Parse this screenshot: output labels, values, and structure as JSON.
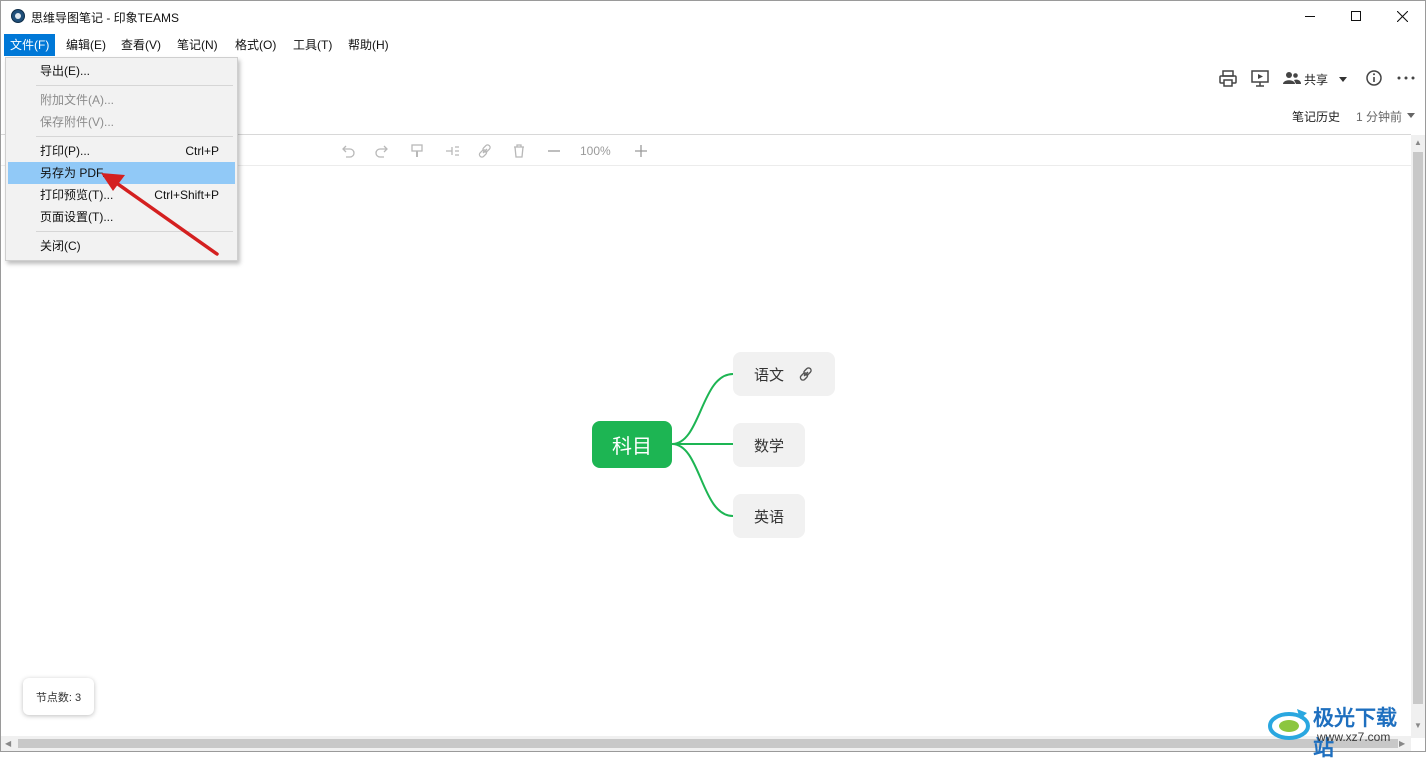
{
  "window": {
    "title": "思维导图笔记 - 印象TEAMS",
    "icon": "evernote-teams-app-icon"
  },
  "menubar": {
    "items": [
      {
        "label": "文件(F)",
        "active": true
      },
      {
        "label": "编辑(E)"
      },
      {
        "label": "查看(V)"
      },
      {
        "label": "笔记(N)"
      },
      {
        "label": "格式(O)"
      },
      {
        "label": "工具(T)"
      },
      {
        "label": "帮助(H)"
      }
    ]
  },
  "file_menu": {
    "items": [
      {
        "label": "导出(E)...",
        "shortcut": "",
        "disabled": false
      },
      {
        "label": "附加文件(A)...",
        "shortcut": "",
        "disabled": true
      },
      {
        "label": "保存附件(V)...",
        "shortcut": "",
        "disabled": true
      },
      {
        "label": "打印(P)...",
        "shortcut": "Ctrl+P",
        "disabled": false
      },
      {
        "label": "另存为 PDF...",
        "shortcut": "",
        "disabled": false,
        "highlighted": true
      },
      {
        "label": "打印预览(T)...",
        "shortcut": "Ctrl+Shift+P",
        "disabled": false
      },
      {
        "label": "页面设置(T)...",
        "shortcut": "",
        "disabled": false
      },
      {
        "label": "关闭(C)",
        "shortcut": "",
        "disabled": false
      }
    ]
  },
  "note_toolbar": {
    "share_label": "共享",
    "history_label": "笔记历史",
    "history_time": "1 分钟前"
  },
  "editor_toolbar": {
    "zoom": "100%"
  },
  "mindmap": {
    "root": "科目",
    "children": [
      "语文",
      "数学",
      "英语"
    ]
  },
  "status": {
    "node_count": "节点数: 3"
  },
  "watermark": {
    "text": "极光下载站",
    "url": "www.xz7.com"
  },
  "colors": {
    "accent": "#0078d7",
    "root_node": "#1db553",
    "branch": "#1db553",
    "menu_highlight": "#91c9f7",
    "arrow": "#d42020"
  }
}
